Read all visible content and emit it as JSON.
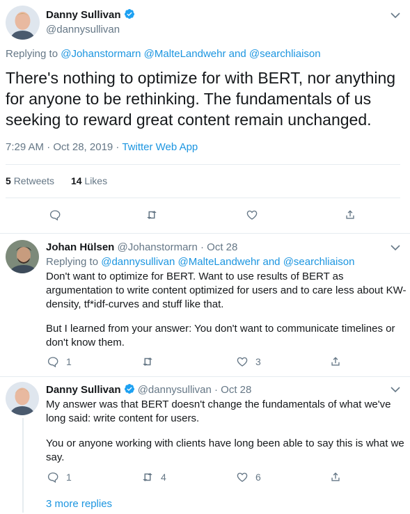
{
  "main_tweet": {
    "name": "Danny Sullivan",
    "handle": "@dannysullivan",
    "replying_prefix": "Replying to",
    "replying_to": [
      "@Johanstormarn",
      "@MalteLandwehr",
      "and",
      "@searchliaison"
    ],
    "text": "There's nothing to optimize for with BERT, nor anything for anyone to be rethinking. The fundamentals of us seeking to reward great content remain unchanged.",
    "timestamp": "7:29 AM · Oct 28, 2019 ·",
    "client": "Twitter Web App",
    "retweets_count": "5",
    "retweets_label": "Retweets",
    "likes_count": "14",
    "likes_label": "Likes"
  },
  "reply1": {
    "name": "Johan Hülsen",
    "handle": "@Johanstormarn",
    "date": "· Oct 28",
    "replying_prefix": "Replying to",
    "replying_to": [
      "@dannysullivan",
      "@MalteLandwehr",
      "and",
      "@searchliaison"
    ],
    "paragraph1": "Don't want to optimize for BERT. Want to use results of BERT as argumentation to write content optimized for users and to care less about KW-density, tf*idf-curves and stuff like that.",
    "paragraph2": "But I learned from your answer: You don't want to communicate timelines or don't know them.",
    "reply_count": "1",
    "retweet_count": "",
    "like_count": "3"
  },
  "reply2": {
    "name": "Danny Sullivan",
    "handle": "@dannysullivan",
    "date": "· Oct 28",
    "paragraph1": "My answer was that BERT doesn't change the fundamentals of what we've long said: write content for users.",
    "paragraph2": "You or anyone working with clients have long been able to say this is what we say.",
    "reply_count": "1",
    "retweet_count": "4",
    "like_count": "6"
  },
  "more_replies": "3 more replies",
  "colors": {
    "accent": "#1b95e0",
    "muted": "#657786",
    "divider": "#e6ecf0",
    "text": "#14171a"
  }
}
